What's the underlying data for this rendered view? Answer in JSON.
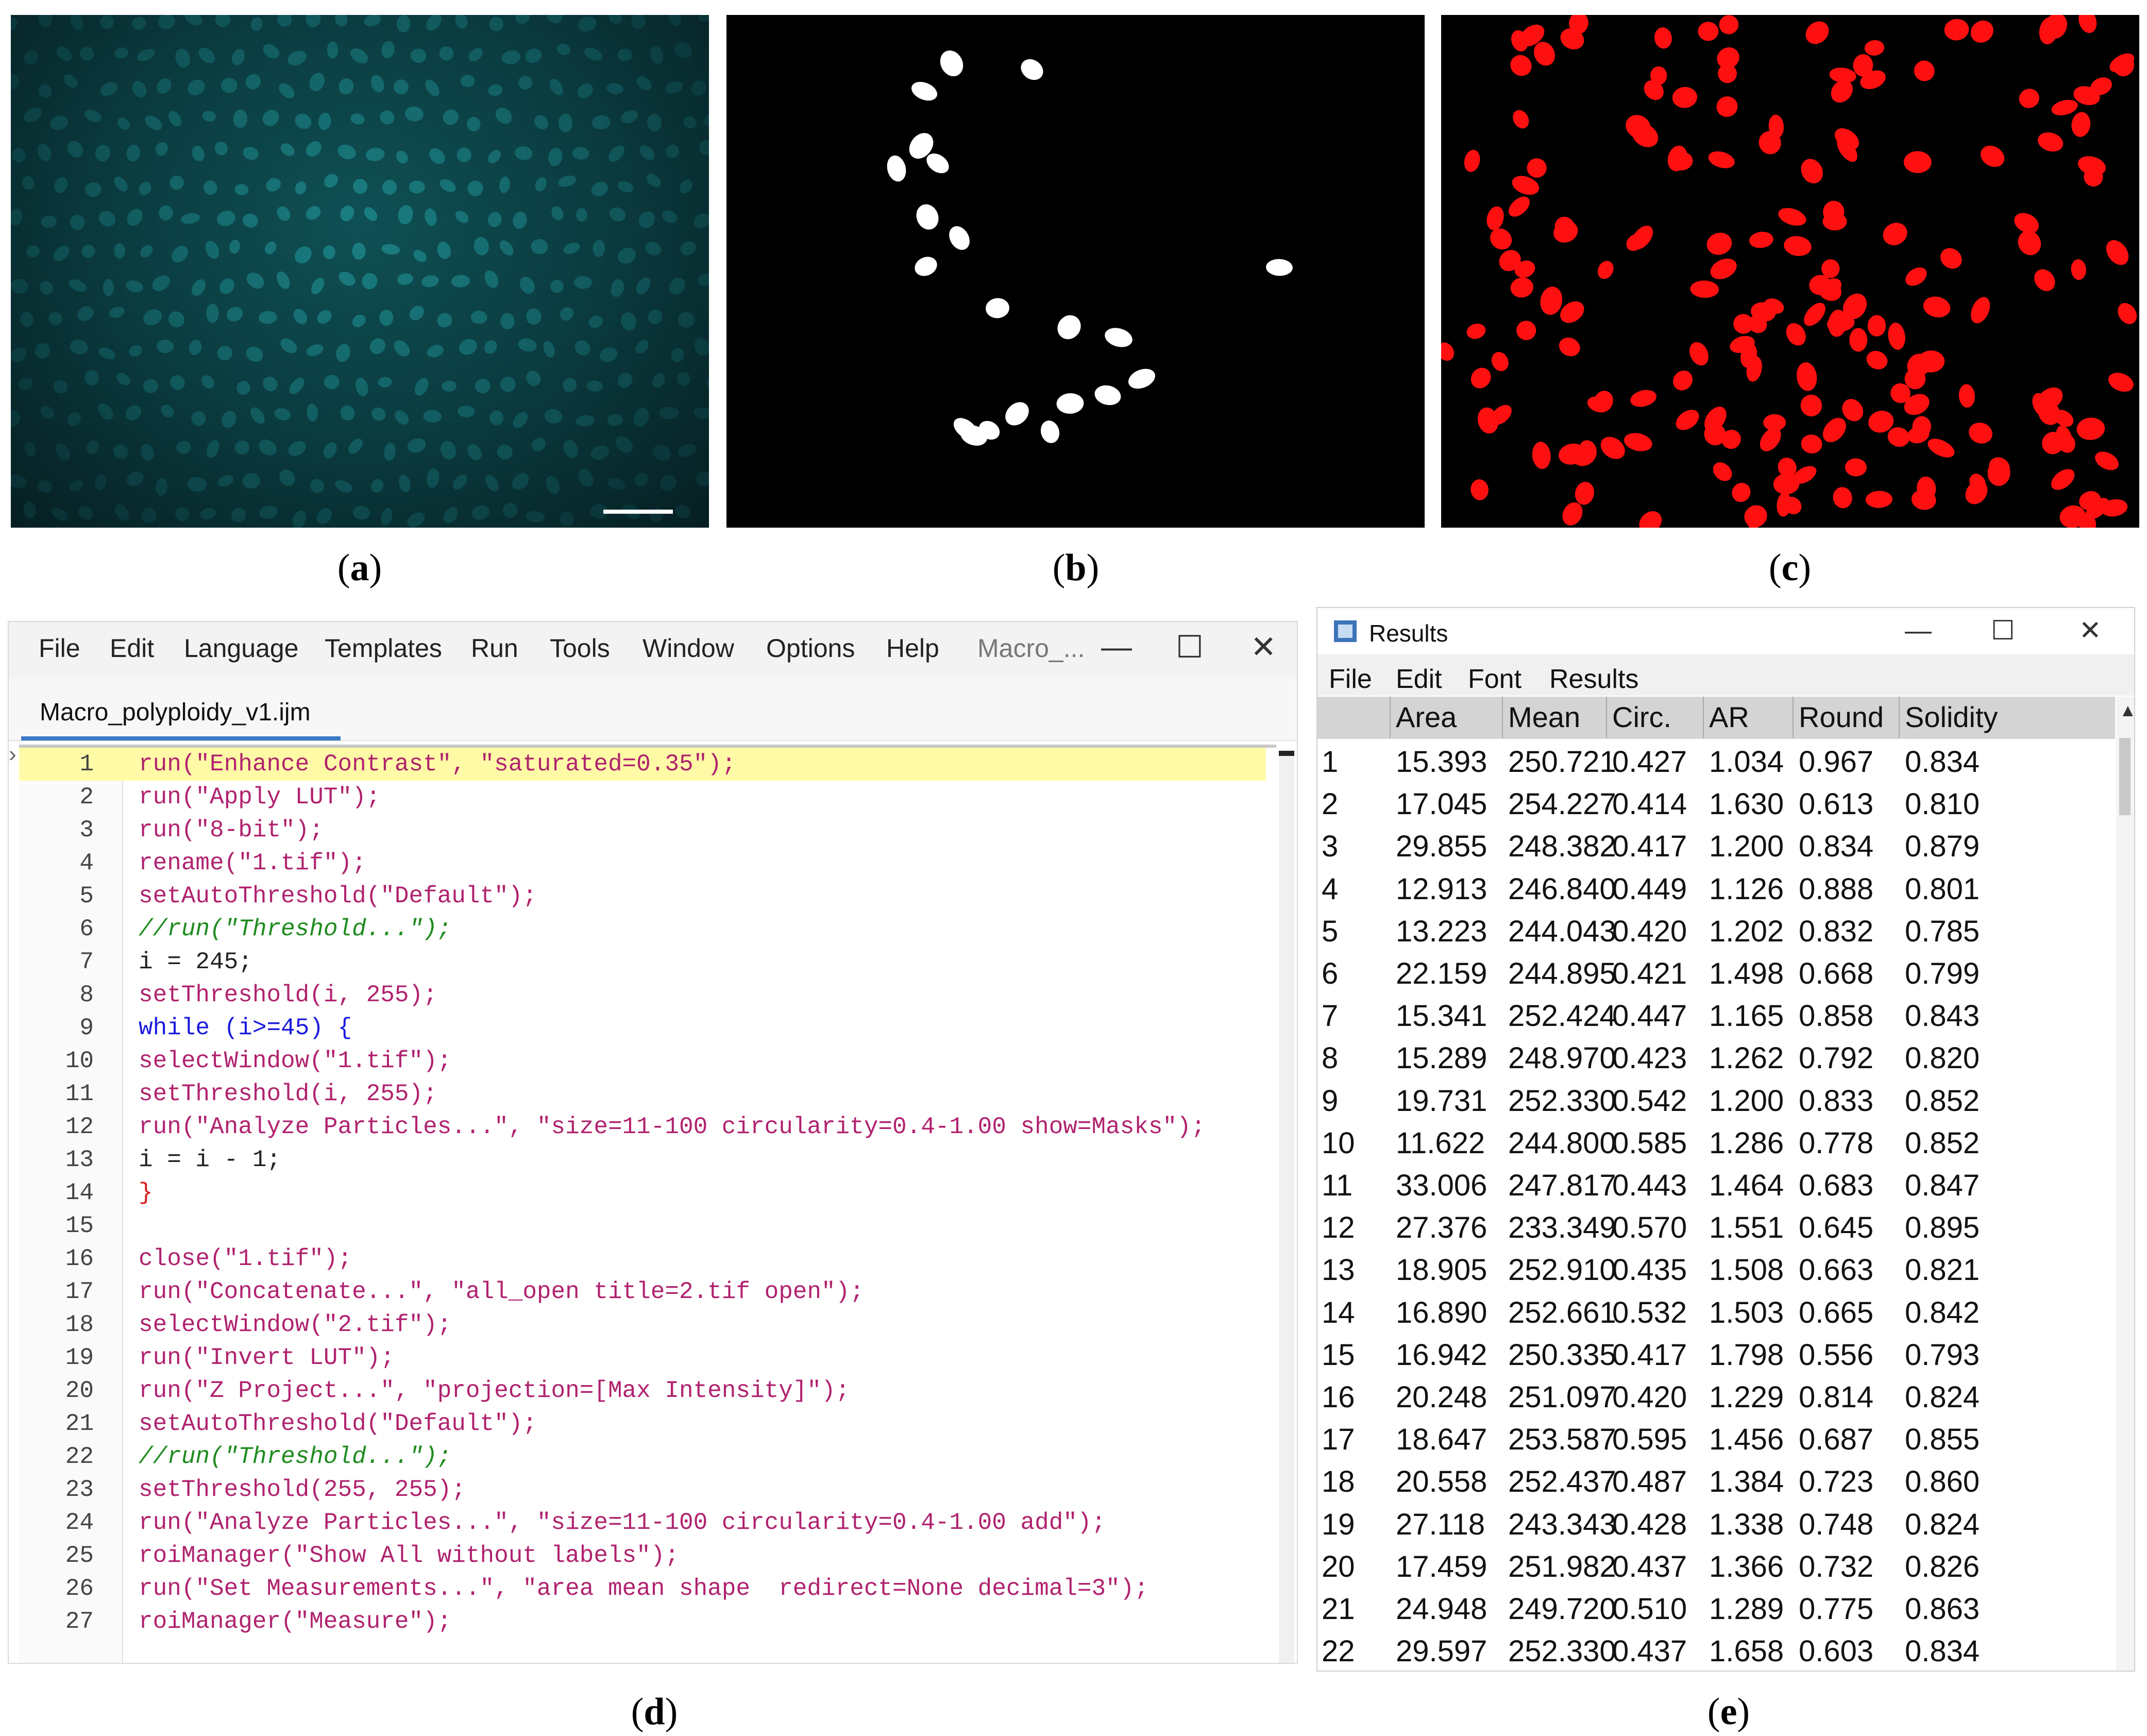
{
  "captions": {
    "a": "a",
    "b": "b",
    "c": "c",
    "d": "d",
    "e": "e"
  },
  "colors": {
    "nuclei_fluor": "#1f8f92",
    "mask_white": "#ffffff",
    "mask_red": "#ff1010",
    "string": "#b0226e",
    "keyword": "#1a1adc",
    "number": "#7a1fc2",
    "comment": "#1e8b1e",
    "highlight": "#fffaa6"
  },
  "editor": {
    "menu": [
      "File",
      "Edit",
      "Language",
      "Templates",
      "Run",
      "Tools",
      "Window",
      "Options",
      "Help"
    ],
    "window_title": "Macro_...",
    "minimize": "—",
    "maximize": "☐",
    "close": "✕",
    "tab": "Macro_polyploidy_v1.ijm",
    "lines": [
      {
        "n": "1",
        "code": "run(\"Enhance Contrast\", \"saturated=0.35\");"
      },
      {
        "n": "2",
        "code": "run(\"Apply LUT\");"
      },
      {
        "n": "3",
        "code": "run(\"8-bit\");"
      },
      {
        "n": "4",
        "code": "rename(\"1.tif\");"
      },
      {
        "n": "5",
        "code": "setAutoThreshold(\"Default\");"
      },
      {
        "n": "6",
        "code": "//run(\"Threshold...\");"
      },
      {
        "n": "7",
        "code": "i = 245;"
      },
      {
        "n": "8",
        "code": "setThreshold(i, 255);"
      },
      {
        "n": "9",
        "code": "while (i>=45) {"
      },
      {
        "n": "10",
        "code": "selectWindow(\"1.tif\");"
      },
      {
        "n": "11",
        "code": "setThreshold(i, 255);"
      },
      {
        "n": "12",
        "code": "run(\"Analyze Particles...\", \"size=11-100 circularity=0.4-1.00 show=Masks\");"
      },
      {
        "n": "13",
        "code": "i = i - 1;"
      },
      {
        "n": "14",
        "code": "}"
      },
      {
        "n": "15",
        "code": ""
      },
      {
        "n": "16",
        "code": "close(\"1.tif\");"
      },
      {
        "n": "17",
        "code": "run(\"Concatenate...\", \"all_open title=2.tif open\");"
      },
      {
        "n": "18",
        "code": "selectWindow(\"2.tif\");"
      },
      {
        "n": "19",
        "code": "run(\"Invert LUT\");"
      },
      {
        "n": "20",
        "code": "run(\"Z Project...\", \"projection=[Max Intensity]\");"
      },
      {
        "n": "21",
        "code": "setAutoThreshold(\"Default\");"
      },
      {
        "n": "22",
        "code": "//run(\"Threshold...\");"
      },
      {
        "n": "23",
        "code": "setThreshold(255, 255);"
      },
      {
        "n": "24",
        "code": "run(\"Analyze Particles...\", \"size=11-100 circularity=0.4-1.00 add\");"
      },
      {
        "n": "25",
        "code": "roiManager(\"Show All without labels\");"
      },
      {
        "n": "26",
        "code": "run(\"Set Measurements...\", \"area mean shape  redirect=None decimal=3\");"
      },
      {
        "n": "27",
        "code": "roiManager(\"Measure\");"
      }
    ]
  },
  "results": {
    "title": "Results",
    "minimize": "—",
    "maximize": "☐",
    "close": "✕",
    "menu": [
      "File",
      "Edit",
      "Font",
      "Results"
    ],
    "columns": [
      "",
      "Area",
      "Mean",
      "Circ.",
      "AR",
      "Round",
      "Solidity"
    ],
    "rows": [
      [
        "1",
        "15.393",
        "250.721",
        "0.427",
        "1.034",
        "0.967",
        "0.834"
      ],
      [
        "2",
        "17.045",
        "254.227",
        "0.414",
        "1.630",
        "0.613",
        "0.810"
      ],
      [
        "3",
        "29.855",
        "248.382",
        "0.417",
        "1.200",
        "0.834",
        "0.879"
      ],
      [
        "4",
        "12.913",
        "246.840",
        "0.449",
        "1.126",
        "0.888",
        "0.801"
      ],
      [
        "5",
        "13.223",
        "244.043",
        "0.420",
        "1.202",
        "0.832",
        "0.785"
      ],
      [
        "6",
        "22.159",
        "244.895",
        "0.421",
        "1.498",
        "0.668",
        "0.799"
      ],
      [
        "7",
        "15.341",
        "252.424",
        "0.447",
        "1.165",
        "0.858",
        "0.843"
      ],
      [
        "8",
        "15.289",
        "248.970",
        "0.423",
        "1.262",
        "0.792",
        "0.820"
      ],
      [
        "9",
        "19.731",
        "252.330",
        "0.542",
        "1.200",
        "0.833",
        "0.852"
      ],
      [
        "10",
        "11.622",
        "244.800",
        "0.585",
        "1.286",
        "0.778",
        "0.852"
      ],
      [
        "11",
        "33.006",
        "247.817",
        "0.443",
        "1.464",
        "0.683",
        "0.847"
      ],
      [
        "12",
        "27.376",
        "233.349",
        "0.570",
        "1.551",
        "0.645",
        "0.895"
      ],
      [
        "13",
        "18.905",
        "252.910",
        "0.435",
        "1.508",
        "0.663",
        "0.821"
      ],
      [
        "14",
        "16.890",
        "252.661",
        "0.532",
        "1.503",
        "0.665",
        "0.842"
      ],
      [
        "15",
        "16.942",
        "250.335",
        "0.417",
        "1.798",
        "0.556",
        "0.793"
      ],
      [
        "16",
        "20.248",
        "251.097",
        "0.420",
        "1.229",
        "0.814",
        "0.824"
      ],
      [
        "17",
        "18.647",
        "253.587",
        "0.595",
        "1.456",
        "0.687",
        "0.855"
      ],
      [
        "18",
        "20.558",
        "252.437",
        "0.487",
        "1.384",
        "0.723",
        "0.860"
      ],
      [
        "19",
        "27.118",
        "243.343",
        "0.428",
        "1.338",
        "0.748",
        "0.824"
      ],
      [
        "20",
        "17.459",
        "251.982",
        "0.437",
        "1.366",
        "0.732",
        "0.826"
      ],
      [
        "21",
        "24.948",
        "249.720",
        "0.510",
        "1.289",
        "0.775",
        "0.863"
      ],
      [
        "22",
        "29.597",
        "252.330",
        "0.437",
        "1.658",
        "0.603",
        "0.834"
      ]
    ]
  }
}
